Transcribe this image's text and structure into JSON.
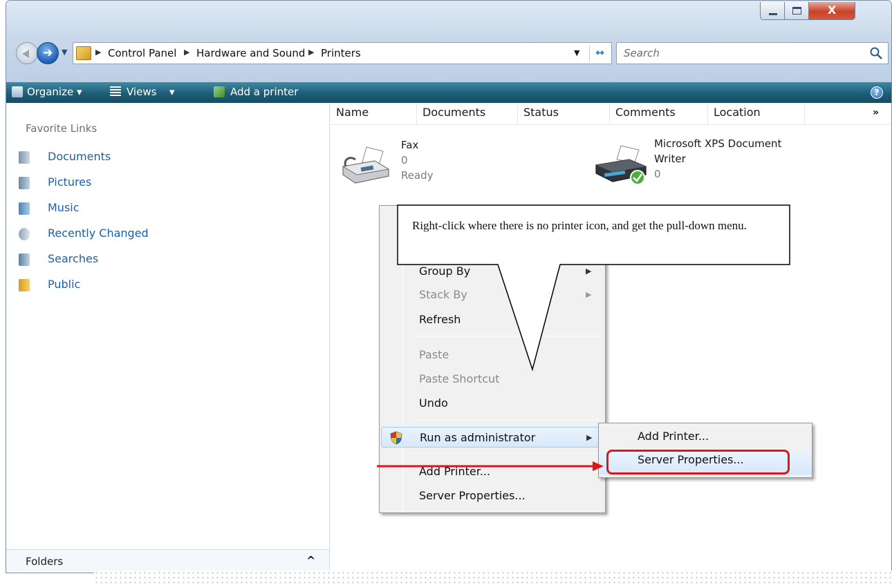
{
  "window": {
    "buttons": {
      "minimize": "–",
      "maximize": "☐",
      "close": "X"
    }
  },
  "address": {
    "breadcrumbs": [
      "Control Panel",
      "Hardware and Sound",
      "Printers"
    ],
    "search_placeholder": "Search"
  },
  "toolbar": {
    "organize": "Organize",
    "views": "Views",
    "add_printer": "Add a printer",
    "help": "?"
  },
  "sidebar": {
    "favorites_title": "Favorite Links",
    "items": [
      {
        "label": "Documents",
        "icon": "documents-icon"
      },
      {
        "label": "Pictures",
        "icon": "pictures-icon"
      },
      {
        "label": "Music",
        "icon": "music-icon"
      },
      {
        "label": "Recently Changed",
        "icon": "recently-changed-icon"
      },
      {
        "label": "Searches",
        "icon": "searches-icon"
      },
      {
        "label": "Public",
        "icon": "public-folder-icon"
      }
    ],
    "folders_label": "Folders",
    "folders_chevron": "^"
  },
  "columns": [
    "Name",
    "Documents",
    "Status",
    "Comments",
    "Location"
  ],
  "more_columns": "»",
  "printers": [
    {
      "name": "Fax",
      "documents": "0",
      "status": "Ready"
    },
    {
      "name_line1": "Microsoft XPS Document",
      "name_line2": "Writer",
      "documents": "0"
    }
  ],
  "context_menu": {
    "items": [
      {
        "label": "Group By",
        "disabled": false,
        "submenu": true
      },
      {
        "label": "Stack By",
        "disabled": true,
        "submenu": true
      },
      {
        "label": "Refresh",
        "disabled": false
      },
      {
        "label": "Paste",
        "disabled": true
      },
      {
        "label": "Paste Shortcut",
        "disabled": true
      },
      {
        "label": "Undo",
        "disabled": false
      },
      {
        "label": "Run as administrator",
        "disabled": false,
        "submenu": true
      },
      {
        "label": "Add Printer...",
        "disabled": false
      },
      {
        "label": "Server Properties...",
        "disabled": false
      }
    ],
    "arrow_glyph": "▶"
  },
  "submenu": {
    "items": [
      "Add Printer...",
      "Server Properties..."
    ]
  },
  "callout": {
    "text": "Right-click where there is no printer icon, and get the pull-down menu."
  },
  "colors": {
    "accent": "#1b5fa8",
    "command_bar": "#1e5d78",
    "highlight_red": "#e01515"
  }
}
